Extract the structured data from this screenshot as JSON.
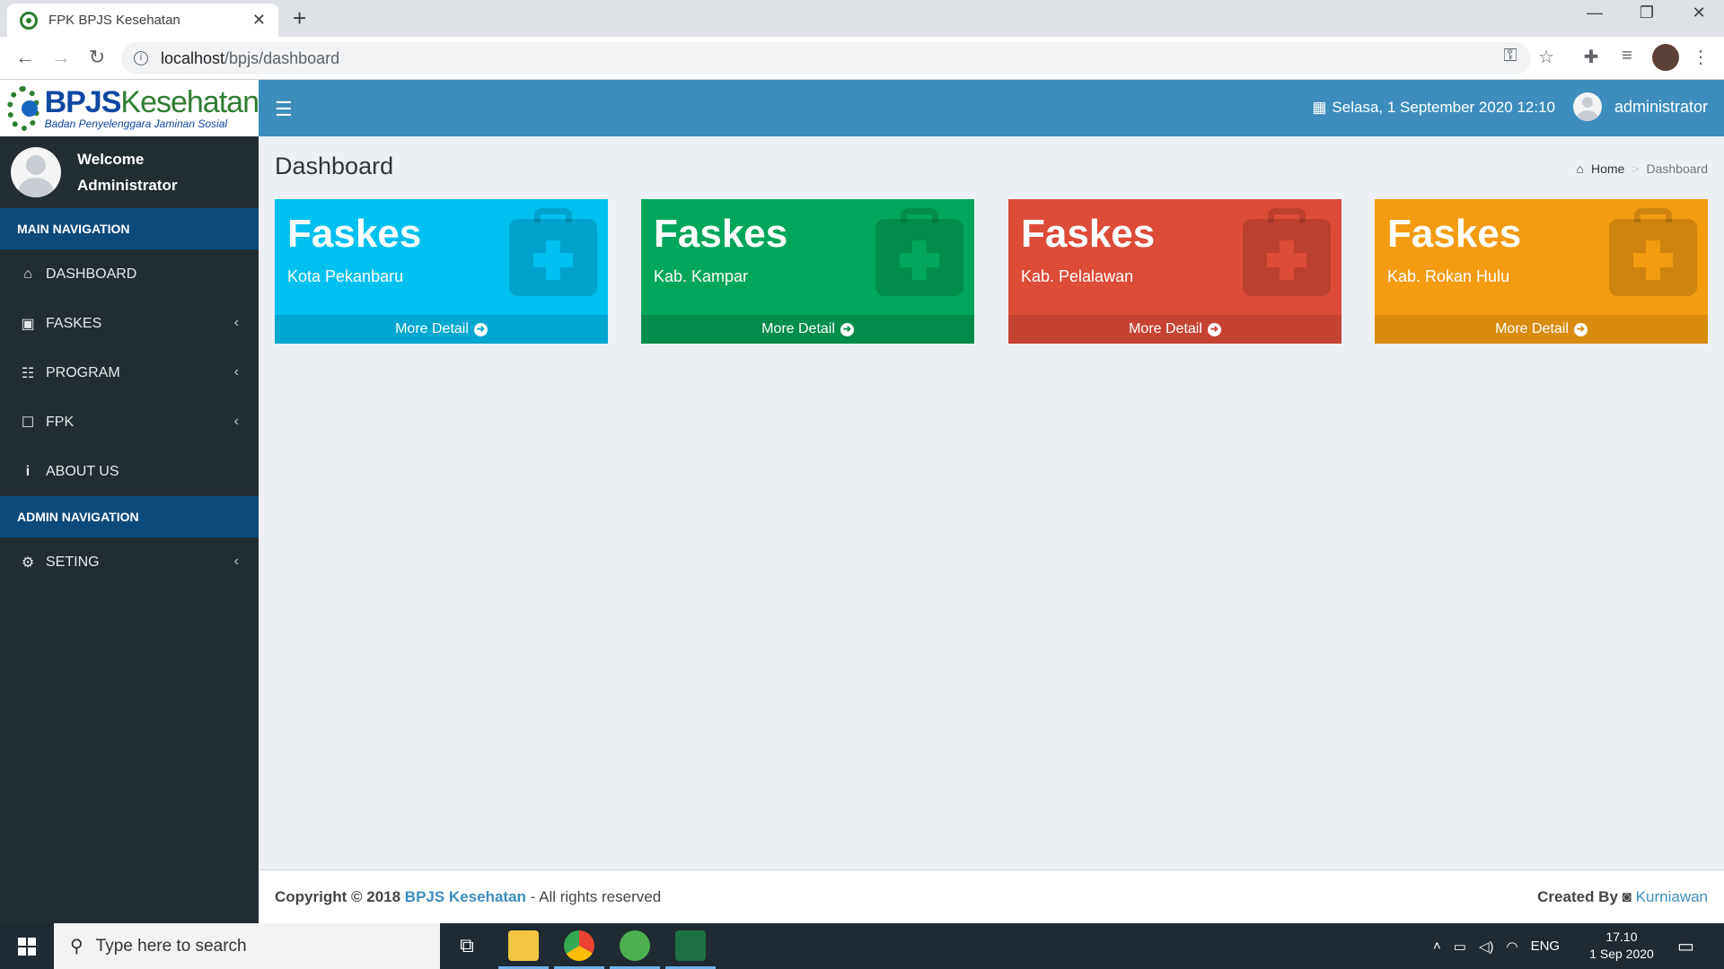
{
  "browser": {
    "tab_title": "FPK BPJS Kesehatan",
    "url_host": "localhost",
    "url_path": "/bpjs/dashboard"
  },
  "logo": {
    "name_main": "BPJS",
    "name_accent": "Kesehatan",
    "tagline": "Badan Penyelenggara Jaminan Sosial"
  },
  "header": {
    "datetime": "Selasa, 1 September 2020 12:10",
    "username": "administrator"
  },
  "sidebar": {
    "welcome": "Welcome",
    "user_name": "Administrator",
    "main_nav_title": "MAIN NAVIGATION",
    "admin_nav_title": "ADMIN NAVIGATION",
    "items": [
      {
        "label": "DASHBOARD",
        "icon": "home-icon"
      },
      {
        "label": "FASKES",
        "icon": "briefcase-icon"
      },
      {
        "label": "PROGRAM",
        "icon": "list-icon"
      },
      {
        "label": "FPK",
        "icon": "edit-icon"
      },
      {
        "label": "ABOUT US",
        "icon": "info-icon"
      }
    ],
    "admin_items": [
      {
        "label": "SETING",
        "icon": "gears-icon"
      }
    ]
  },
  "page": {
    "title": "Dashboard",
    "breadcrumb_home": "Home",
    "breadcrumb_current": "Dashboard"
  },
  "cards": [
    {
      "title": "Faskes",
      "subtitle": "Kota Pekanbaru",
      "link": "More Detail",
      "color": "#00c0ef",
      "footer_color": "#00a7d0"
    },
    {
      "title": "Faskes",
      "subtitle": "Kab. Kampar",
      "link": "More Detail",
      "color": "#00a65a",
      "footer_color": "#008d4c"
    },
    {
      "title": "Faskes",
      "subtitle": "Kab. Pelalawan",
      "link": "More Detail",
      "color": "#dd4b39",
      "footer_color": "#c64333"
    },
    {
      "title": "Faskes",
      "subtitle": "Kab. Rokan Hulu",
      "link": "More Detail",
      "color": "#f39c12",
      "footer_color": "#da8c10"
    }
  ],
  "footer": {
    "copyright_prefix": "Copyright © 2018",
    "brand": "BPJS Kesehatan",
    "rights": "- All rights reserved",
    "created_by": "Created By",
    "author": "Kurniawan"
  },
  "taskbar": {
    "search_placeholder": "Type here to search",
    "language": "ENG",
    "time": "17.10",
    "date": "1 Sep 2020"
  },
  "colors": {
    "header_blue": "#3c8dbc",
    "sidebar_dark": "#222d32",
    "section_header": "#0d4a7a",
    "content_bg": "#ecf0f5"
  }
}
